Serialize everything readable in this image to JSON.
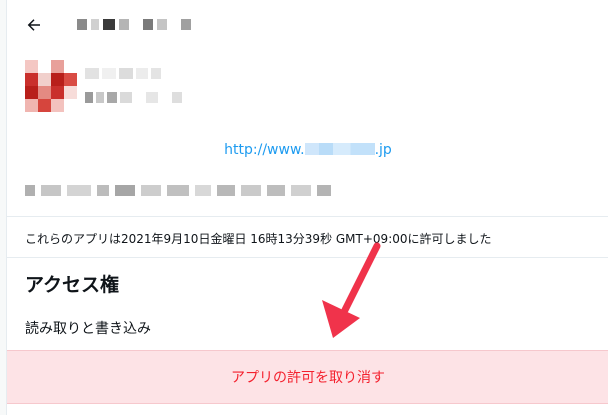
{
  "header": {
    "back_icon": "arrow-left-icon"
  },
  "app": {
    "link_text": "http://www.",
    "link_suffix": ".jp",
    "icon_color": "#c9302c"
  },
  "granted_text": "これらのアプリは2021年9月10日金曜日 16時13分39秒 GMT+09:00に許可しました",
  "access": {
    "title": "アクセス権",
    "value": "読み取りと書き込み"
  },
  "revoke_button_label": "アプリの許可を取り消す",
  "colors": {
    "link": "#1d9bf0",
    "danger": "#f4212e",
    "danger_bg": "#fde3e6",
    "annotation_arrow": "#f0334b"
  }
}
